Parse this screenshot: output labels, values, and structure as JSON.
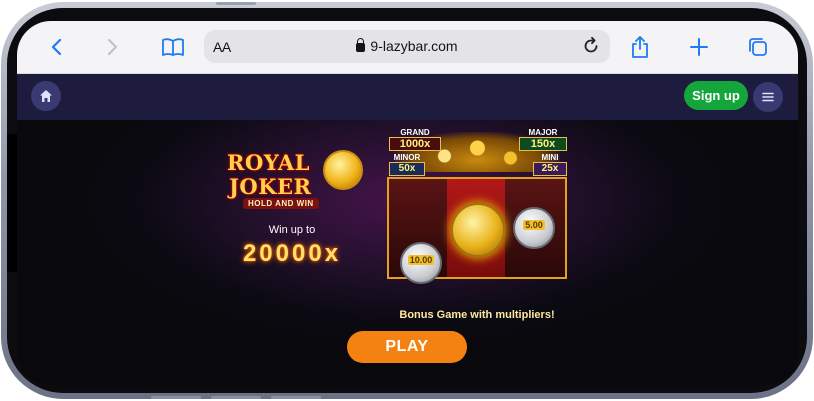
{
  "browser": {
    "text_size_label": "AA",
    "url": "9-lazybar.com",
    "icons": [
      "back-icon",
      "forward-icon",
      "bookmarks-icon",
      "lock-icon",
      "reload-icon",
      "share-icon",
      "new-tab-icon",
      "tabs-icon"
    ]
  },
  "site": {
    "signup_label": "Sign up"
  },
  "game": {
    "logo_line1": "ROYAL",
    "logo_line2": "JOKER",
    "logo_tagline": "HOLD AND WIN",
    "win_up_to": "Win up to",
    "max_multiplier": "20000x",
    "jackpots": {
      "grand": {
        "name": "GRAND",
        "value": "1000x"
      },
      "major": {
        "name": "MAJOR",
        "value": "150x"
      },
      "minor": {
        "name": "MINOR",
        "value": "50x"
      },
      "mini": {
        "name": "MINI",
        "value": "25x"
      }
    },
    "coin_values": {
      "left": "10.00",
      "right": "5.00"
    },
    "bonus_text": "Bonus Game with multipliers!",
    "play_label": "PLAY"
  },
  "colors": {
    "accent": "#1f7bf2",
    "header_bg": "#1d1c3f",
    "signup": "#14a53b",
    "play": "#f48213"
  }
}
